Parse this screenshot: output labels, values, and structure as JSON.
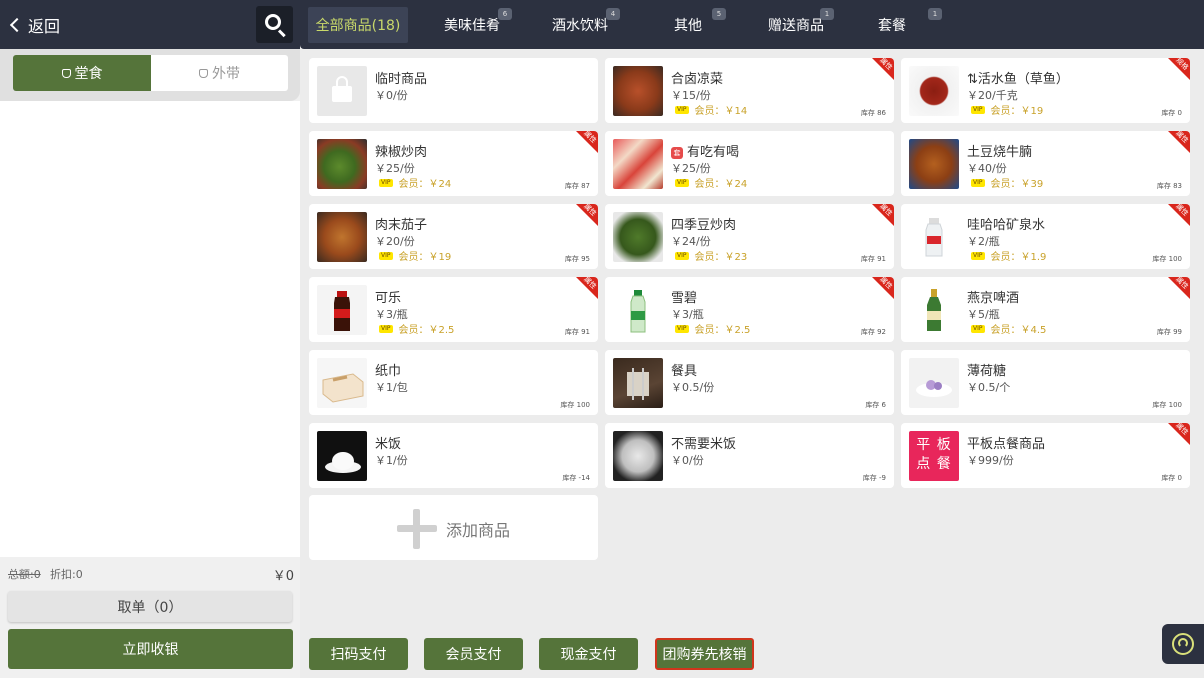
{
  "header": {
    "back_label": "返回"
  },
  "modes": {
    "dine_in": "堂食",
    "takeaway": "外带"
  },
  "summary": {
    "total": "总额:0",
    "discount": "折扣:0",
    "amount": "￥0"
  },
  "left_buttons": {
    "pickup": "取单（0）",
    "checkout": "立即收银"
  },
  "categories": [
    {
      "label": "全部商品(18)",
      "badge": ""
    },
    {
      "label": "美味佳肴",
      "badge": "6"
    },
    {
      "label": "酒水饮料",
      "badge": "4"
    },
    {
      "label": "其他",
      "badge": "5"
    },
    {
      "label": "赠送商品",
      "badge": "1"
    },
    {
      "label": "套餐",
      "badge": "1"
    }
  ],
  "products": [
    {
      "name": "临时商品",
      "price": "￥0/份",
      "member": "",
      "stock": "",
      "corner": ""
    },
    {
      "name": "合卤凉菜",
      "price": "￥15/份",
      "member": "会员：￥14",
      "stock": "库存 86",
      "corner": "属性"
    },
    {
      "name": "活水鱼（草鱼）",
      "price": "￥20/千克",
      "member": "会员：￥19",
      "stock": "库存 0",
      "corner": "规格"
    },
    {
      "name": "辣椒炒肉",
      "price": "￥25/份",
      "member": "会员：￥24",
      "stock": "库存 87",
      "corner": "属性"
    },
    {
      "name": "有吃有喝",
      "price": "￥25/份",
      "member": "会员：￥24",
      "stock": "",
      "corner": ""
    },
    {
      "name": "土豆烧牛腩",
      "price": "￥40/份",
      "member": "会员：￥39",
      "stock": "库存 83",
      "corner": "属性"
    },
    {
      "name": "肉末茄子",
      "price": "￥20/份",
      "member": "会员：￥19",
      "stock": "库存 95",
      "corner": "属性"
    },
    {
      "name": "四季豆炒肉",
      "price": "￥24/份",
      "member": "会员：￥23",
      "stock": "库存 91",
      "corner": "属性"
    },
    {
      "name": "哇哈哈矿泉水",
      "price": "￥2/瓶",
      "member": "会员：￥1.9",
      "stock": "库存 100",
      "corner": "属性"
    },
    {
      "name": "可乐",
      "price": "￥3/瓶",
      "member": "会员：￥2.5",
      "stock": "库存 91",
      "corner": "属性"
    },
    {
      "name": "雪碧",
      "price": "￥3/瓶",
      "member": "会员：￥2.5",
      "stock": "库存 92",
      "corner": "属性"
    },
    {
      "name": "燕京啤酒",
      "price": "￥5/瓶",
      "member": "会员：￥4.5",
      "stock": "库存 99",
      "corner": "属性"
    },
    {
      "name": "纸巾",
      "price": "￥1/包",
      "member": "",
      "stock": "库存 100",
      "corner": ""
    },
    {
      "name": "餐具",
      "price": "￥0.5/份",
      "member": "",
      "stock": "库存 6",
      "corner": ""
    },
    {
      "name": "薄荷糖",
      "price": "￥0.5/个",
      "member": "",
      "stock": "库存 100",
      "corner": ""
    },
    {
      "name": "米饭",
      "price": "￥1/份",
      "member": "",
      "stock": "库存 -14",
      "corner": ""
    },
    {
      "name": "不需要米饭",
      "price": "￥0/份",
      "member": "",
      "stock": "库存 -9",
      "corner": ""
    },
    {
      "name": "平板点餐商品",
      "price": "￥999/份",
      "member": "",
      "stock": "库存 0",
      "corner": "属性"
    }
  ],
  "small_marks": {
    "set_tag": "套",
    "vip": "VIP",
    "fish_prefix": "⇅",
    "tablet_logo": "平 板 点 餐"
  },
  "add_product": "添加商品",
  "payments": [
    "扫码支付",
    "会员支付",
    "现金支付",
    "团购券先核销"
  ],
  "colors": {
    "primary_green": "#55743a",
    "dark_bar": "#2c3140",
    "corner_red": "#d9261c",
    "active_tab_text": "#c9d96a"
  }
}
